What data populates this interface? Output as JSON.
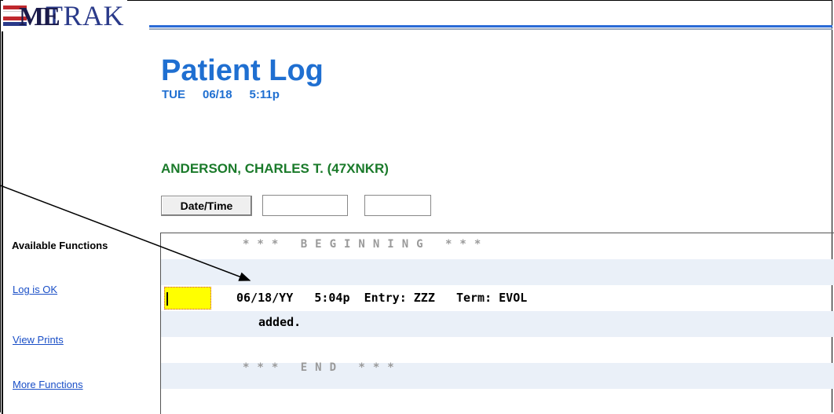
{
  "app": {
    "logo_text": "TRAK",
    "logo_mark": "ME",
    "colors": {
      "accent": "#1f6fd1",
      "patient": "#1a7a2a",
      "link": "#1a4fc7",
      "highlight": "#ffff00"
    }
  },
  "page": {
    "title": "Patient Log",
    "day": "TUE",
    "date": "06/18",
    "time": "5:11p"
  },
  "patient": {
    "name": "ANDERSON, CHARLES T. (47XNKR)"
  },
  "controls": {
    "datetime_label": "Date/Time",
    "field1_value": "",
    "field2_value": ""
  },
  "functions": {
    "title": "Available Functions",
    "items": [
      "Log is OK",
      "View Prints",
      "More Functions"
    ]
  },
  "log": {
    "begin_marker": "*** BEGINNING ***",
    "end_marker": "*** END ***",
    "entry_date": "06/18/YY",
    "entry_time": "5:04p",
    "entry_user_label": "Entry:",
    "entry_user": "ZZZ",
    "entry_term_label": "Term:",
    "entry_term": "EVOL",
    "entry_text": "added."
  }
}
